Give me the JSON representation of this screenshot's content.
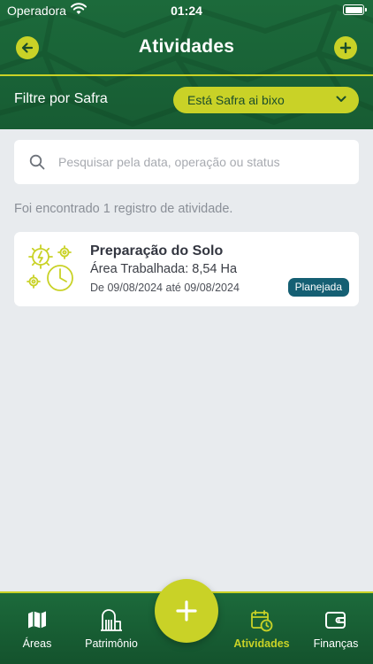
{
  "status_bar": {
    "carrier": "Operadora",
    "time": "01:24"
  },
  "header": {
    "title": "Atividades",
    "back_icon": "arrow-left-icon",
    "add_icon": "plus-icon"
  },
  "filter": {
    "label": "Filtre por Safra",
    "selected": "Está Safra ai bixo"
  },
  "search": {
    "placeholder": "Pesquisar pela data, operação ou status",
    "value": ""
  },
  "results": {
    "count_text": "Foi encontrado 1 registro de atividade."
  },
  "activities": [
    {
      "title": "Preparação do Solo",
      "area": "Área Trabalhada: 8,54 Ha",
      "dates": "De 09/08/2024 até 09/08/2024",
      "status": "Planejada",
      "icon": "gears-clock-icon"
    }
  ],
  "bottom_nav": {
    "tabs": [
      {
        "label": "Áreas",
        "icon": "map-icon"
      },
      {
        "label": "Patrimônio",
        "icon": "building-icon"
      },
      {
        "label": "Atividades",
        "icon": "calendar-clock-icon"
      },
      {
        "label": "Finanças",
        "icon": "wallet-icon"
      }
    ],
    "active": "Atividades",
    "fab_icon": "plus-icon"
  },
  "colors": {
    "primary_green": "#1c6a3b",
    "accent_lime": "#c9d227",
    "badge_teal": "#155f73",
    "background": "#e8ebee"
  }
}
